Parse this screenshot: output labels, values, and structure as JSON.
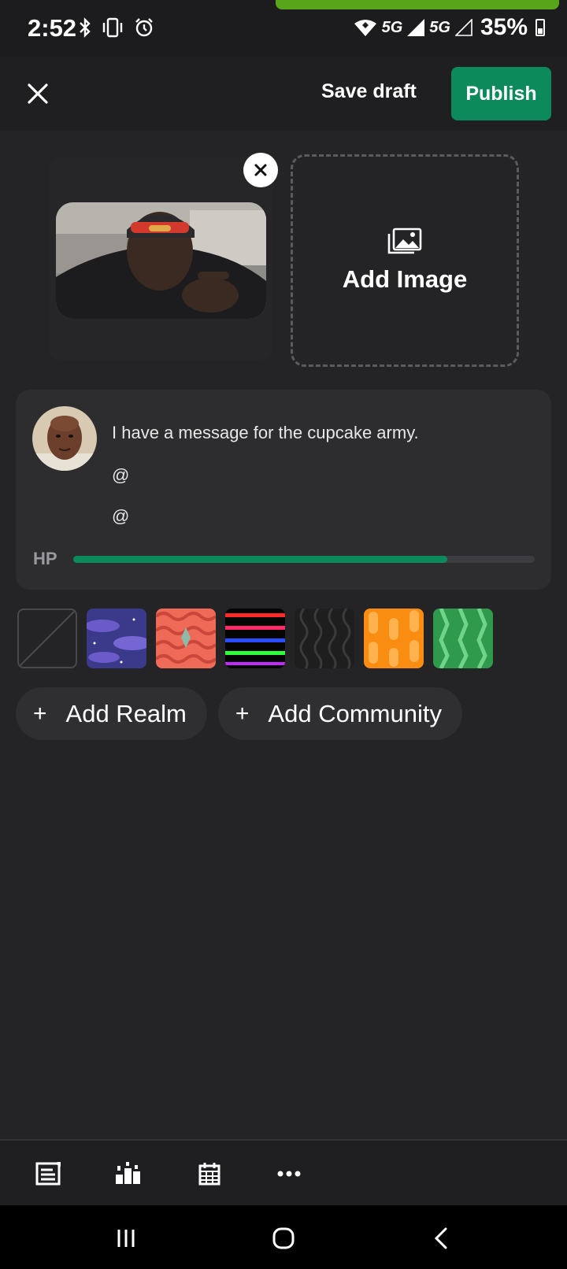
{
  "status_bar": {
    "time": "2:52",
    "network_1": "5G",
    "network_2": "5G",
    "battery": "35%"
  },
  "header": {
    "save_draft": "Save draft",
    "publish": "Publish"
  },
  "images": {
    "add_image_label": "Add Image"
  },
  "post": {
    "text": "I have a message for the cupcake army.",
    "mentions": [
      "@",
      "@"
    ],
    "hp_label": "HP",
    "hp_fraction": 0.81
  },
  "backgrounds": [
    "none",
    "purple-clouds",
    "red-waves",
    "rainbow-stripes",
    "black-waves",
    "orange-dots",
    "green-leaves"
  ],
  "chips": {
    "add_realm": "Add Realm",
    "add_community": "Add Community",
    "plus": "+"
  },
  "toolbar": [
    "article-icon",
    "ranking-icon",
    "calendar-icon",
    "more-icon"
  ],
  "colors": {
    "accent": "#0d8a5c",
    "background": "#242325",
    "card": "#2d2c2f",
    "progress": "#57a61a"
  }
}
